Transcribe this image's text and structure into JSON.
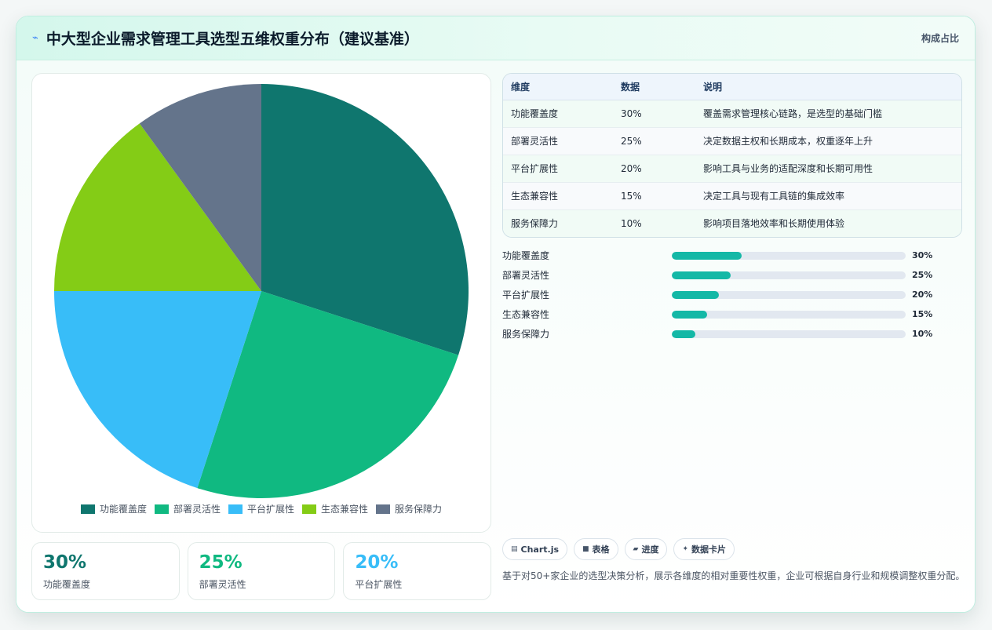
{
  "header": {
    "icon": "lightning-icon",
    "title": "中大型企业需求管理工具选型五维权重分布（建议基准）",
    "badge": "构成占比"
  },
  "chart_data": {
    "type": "pie",
    "categories": [
      "功能覆盖度",
      "部署灵活性",
      "平台扩展性",
      "生态兼容性",
      "服务保障力"
    ],
    "values": [
      30,
      25,
      20,
      15,
      10
    ],
    "colors": [
      "#0f766e",
      "#10b981",
      "#38bdf8",
      "#84cc16",
      "#64748b"
    ],
    "legend_position": "bottom"
  },
  "stats": [
    {
      "value": "30%",
      "label": "功能覆盖度",
      "color": "#0f766e"
    },
    {
      "value": "25%",
      "label": "部署灵活性",
      "color": "#10b981"
    },
    {
      "value": "20%",
      "label": "平台扩展性",
      "color": "#38bdf8"
    }
  ],
  "table": {
    "headers": [
      "维度",
      "数据",
      "说明"
    ],
    "rows": [
      [
        "功能覆盖度",
        "30%",
        "覆盖需求管理核心链路，是选型的基础门槛"
      ],
      [
        "部署灵活性",
        "25%",
        "决定数据主权和长期成本，权重逐年上升"
      ],
      [
        "平台扩展性",
        "20%",
        "影响工具与业务的适配深度和长期可用性"
      ],
      [
        "生态兼容性",
        "15%",
        "决定工具与现有工具链的集成效率"
      ],
      [
        "服务保障力",
        "10%",
        "影响项目落地效率和长期使用体验"
      ]
    ]
  },
  "progress": [
    {
      "label": "功能覆盖度",
      "value": 30,
      "text": "30%"
    },
    {
      "label": "部署灵活性",
      "value": 25,
      "text": "25%"
    },
    {
      "label": "平台扩展性",
      "value": 20,
      "text": "20%"
    },
    {
      "label": "生态兼容性",
      "value": 15,
      "text": "15%"
    },
    {
      "label": "服务保障力",
      "value": 10,
      "text": "10%"
    }
  ],
  "tags": [
    {
      "icon": "▤",
      "label": "Chart.js"
    },
    {
      "icon": "■",
      "label": "表格"
    },
    {
      "icon": "▰",
      "label": "进度"
    },
    {
      "icon": "✦",
      "label": "数据卡片"
    }
  ],
  "footnote": "基于对50+家企业的选型决策分析，展示各维度的相对重要性权重，企业可根据自身行业和规模调整权重分配。"
}
